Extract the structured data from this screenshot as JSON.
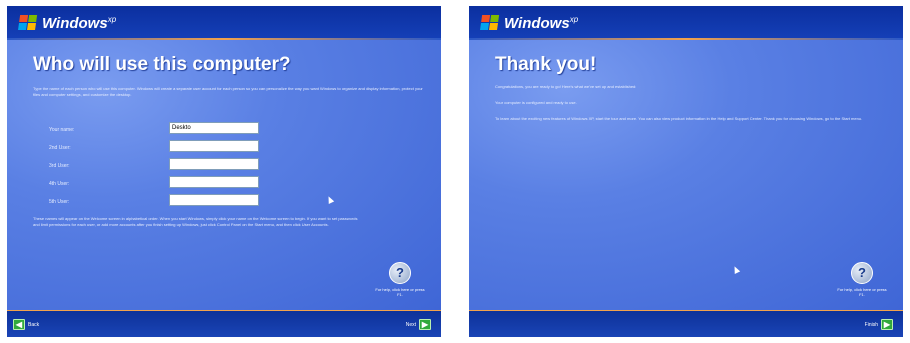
{
  "left_screen": {
    "brand": "Windows",
    "brand_mark": "xp",
    "title": "Who will use this computer?",
    "intro": "Type the name of each person who will use this computer. Windows will create a separate user account for each person so you can personalize the way you want Windows to organize and display information, protect your files and computer settings, and customize the desktop.",
    "users": [
      {
        "label": "Your name:",
        "value": "Deskto"
      },
      {
        "label": "2nd User:",
        "value": ""
      },
      {
        "label": "3rd User:",
        "value": ""
      },
      {
        "label": "4th User:",
        "value": ""
      },
      {
        "label": "5th User:",
        "value": ""
      }
    ],
    "note": "These names will appear on the Welcome screen in alphabetical order. When you start Windows, simply click your name on the Welcome screen to begin. If you want to set passwords and limit permissions for each user, or add more accounts after you finish setting up Windows, just click Control Panel on the Start menu, and then click User Accounts.",
    "help": "For help, click here or press F1.",
    "back": "Back",
    "next": "Next"
  },
  "right_screen": {
    "brand": "Windows",
    "brand_mark": "xp",
    "title": "Thank you!",
    "line1": "Congratulations, you are ready to go! Here's what we've set up and established:",
    "line2": "Your computer is configured and ready to use.",
    "line3": "To learn about the exciting new features of Windows XP, start the tour and more. You can also view product information in the Help and Support Center. Thank you for choosing Windows, go to the Start menu.",
    "help": "For help, click here or press F1.",
    "finish": "Finish"
  },
  "colors": {
    "background_blue": "#3a64d8",
    "header_blue": "#0b2f9f",
    "accent_orange": "#f2a24c",
    "next_green": "#31a93c"
  }
}
